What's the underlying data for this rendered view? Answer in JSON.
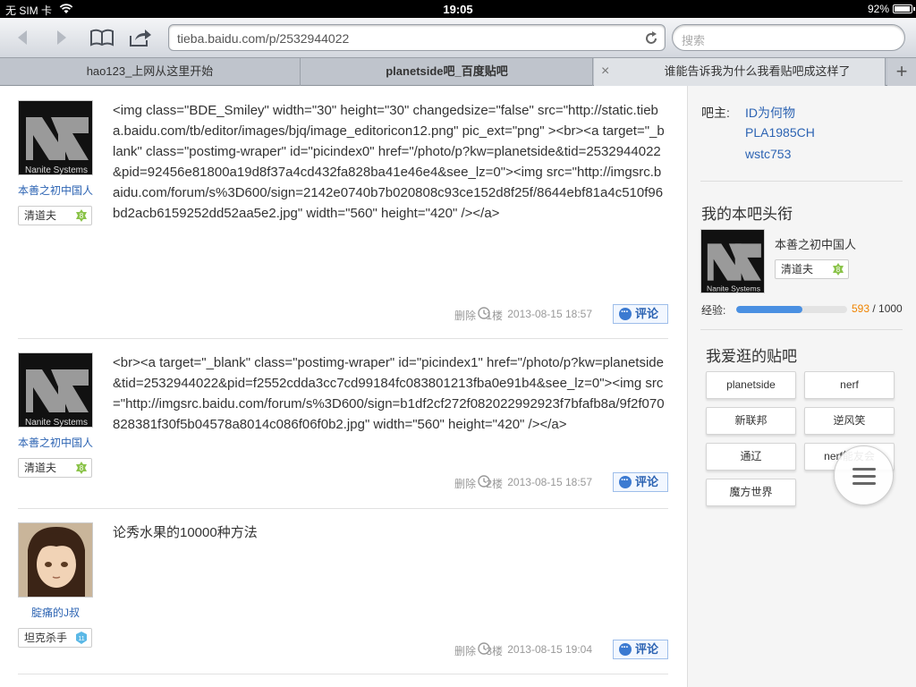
{
  "status": {
    "carrier": "无 SIM 卡",
    "time": "19:05",
    "battery": "92%"
  },
  "toolbar": {
    "url": "tieba.baidu.com/p/2532944022",
    "search_placeholder": "搜索"
  },
  "tabs": [
    {
      "label": "hao123_上网从这里开始"
    },
    {
      "label": "planetside吧_百度贴吧"
    },
    {
      "label": "谁能告诉我为什么我看贴吧成这样了",
      "close": "×"
    }
  ],
  "tab_add": "+",
  "posts": [
    {
      "username": "本善之初中国人",
      "badge": "清道夫",
      "level": "8",
      "content": "<img class=\"BDE_Smiley\" width=\"30\" height=\"30\" changedsize=\"false\" src=\"http://static.tieba.baidu.com/tb/editor/images/bjq/image_editoricon12.png\" pic_ext=\"png\" ><br><a target=\"_blank\" class=\"postimg-wraper\" id=\"picindex0\" href=\"/photo/p?kw=planetside&tid=2532944022&pid=92456e81800a19d8f37a4cd432fa828ba41e46e4&see_lz=0\"><img src=\"http://imgsrc.baidu.com/forum/s%3D600/sign=2142e0740b7b020808c93ce152d8f25f/8644ebf81a4c510f96bd2acb6159252dd52aa5e2.jpg\" width=\"560\" height=\"420\" /></a>",
      "delete": "删除",
      "floor": "1楼",
      "time": "2013-08-15 18:57",
      "comment": "评论",
      "avatar_text": "Nanite Systems"
    },
    {
      "username": "本善之初中国人",
      "badge": "清道夫",
      "level": "8",
      "content": "<br><a target=\"_blank\" class=\"postimg-wraper\" id=\"picindex1\" href=\"/photo/p?kw=planetside&tid=2532944022&pid=f2552cdda3cc7cd99184fc083801213fba0e91b4&see_lz=0\"><img src=\"http://imgsrc.baidu.com/forum/s%3D600/sign=b1df2cf272f082022992923f7bfafb8a/9f2f070828381f30f5b04578a8014c086f06f0b2.jpg\" width=\"560\" height=\"420\" /></a>",
      "delete": "删除",
      "floor": "2楼",
      "time": "2013-08-15 18:57",
      "comment": "评论",
      "avatar_text": "Nanite Systems"
    },
    {
      "username": "腚痛的J叔",
      "badge": "坦克杀手",
      "level": "11",
      "content": "论秀水果的10000种方法",
      "delete": "删除",
      "floor": "3楼",
      "time": "2013-08-15 19:04",
      "comment": "评论"
    }
  ],
  "sidebar": {
    "owner_label": "吧主:",
    "owners": [
      "ID为何物",
      "PLA1985CH",
      "wstc753"
    ],
    "title_heading": "我的本吧头衔",
    "my_name": "本善之初中国人",
    "my_badge": "清道夫",
    "my_level": "8",
    "avatar_text": "Nanite Systems",
    "exp_label": "经验:",
    "exp_current": "593",
    "exp_total": " / 1000",
    "exp_fraction": 0.593,
    "fav_heading": "我爱逛的贴吧",
    "fav_bars": [
      "planetside",
      "nerf",
      "新联邦",
      "逆风笑",
      "通辽",
      "nerf能友会",
      "魔方世界"
    ]
  },
  "colors": {
    "link": "#2d64b3",
    "exp_bar": "#4a90e2",
    "exp_current": "#f08300",
    "level_green": "#8bc34a",
    "level_blue": "#5bb8e6"
  }
}
